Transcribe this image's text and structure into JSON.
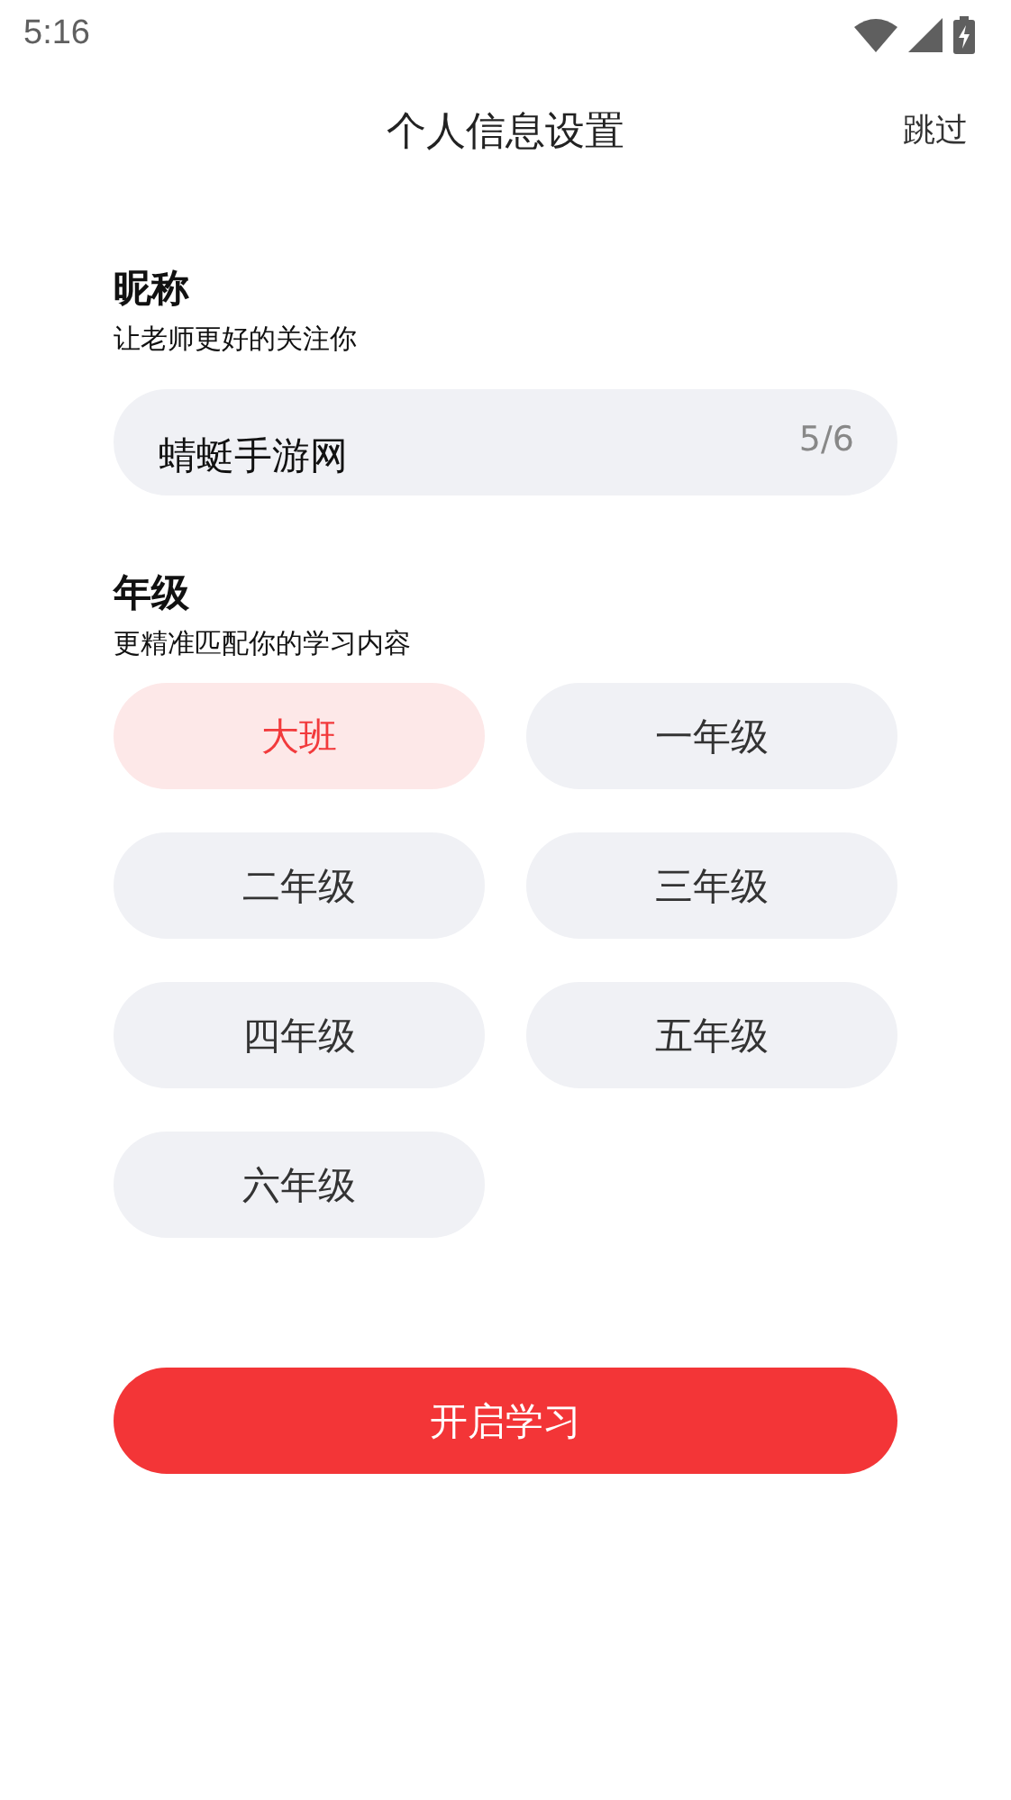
{
  "status_bar": {
    "time": "5:16"
  },
  "header": {
    "title": "个人信息设置",
    "skip": "跳过"
  },
  "nickname": {
    "label": "昵称",
    "hint": "让老师更好的关注你",
    "value": "蜻蜓手游网",
    "counter": "5/6"
  },
  "grade": {
    "label": "年级",
    "hint": "更精准匹配你的学习内容",
    "options": [
      {
        "label": "大班",
        "selected": true
      },
      {
        "label": "一年级",
        "selected": false
      },
      {
        "label": "二年级",
        "selected": false
      },
      {
        "label": "三年级",
        "selected": false
      },
      {
        "label": "四年级",
        "selected": false
      },
      {
        "label": "五年级",
        "selected": false
      },
      {
        "label": "六年级",
        "selected": false
      }
    ]
  },
  "start_button": "开启学习"
}
